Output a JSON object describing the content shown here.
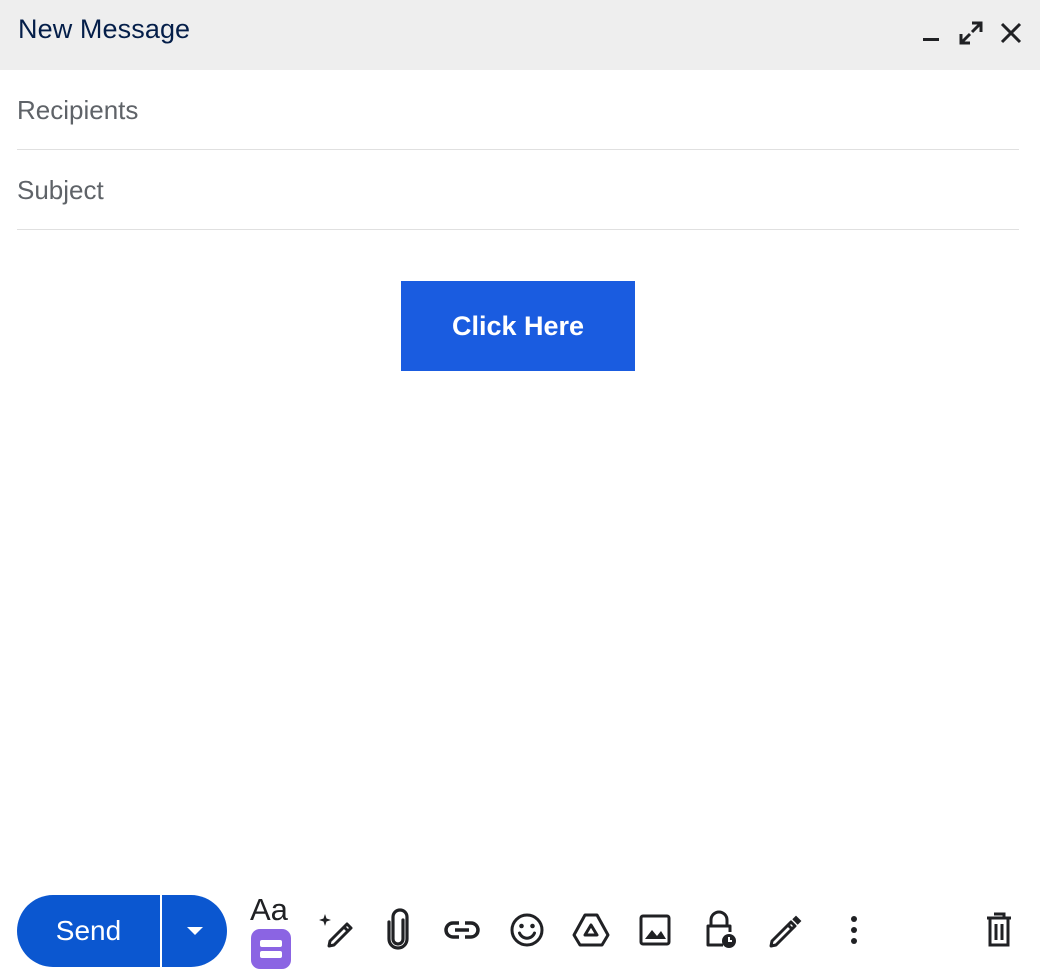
{
  "window": {
    "title": "New Message",
    "controls": [
      "minimize-icon",
      "expand-icon",
      "close-icon"
    ]
  },
  "fields": {
    "recipients": {
      "placeholder": "Recipients",
      "value": ""
    },
    "subject": {
      "placeholder": "Subject",
      "value": ""
    }
  },
  "body": {
    "cta_label": "Click Here",
    "cta_color": "#1a5ce0"
  },
  "toolbar": {
    "send_label": "Send",
    "send_color": "#0b57d0",
    "formatting_label": "Aa",
    "formatting_badge_color": "#8b64e3",
    "icons": [
      "send-options-icon",
      "formatting-icon",
      "ai-write-icon",
      "attach-icon",
      "link-icon",
      "emoji-icon",
      "drive-icon",
      "photo-icon",
      "confidential-icon",
      "signature-icon",
      "more-options-icon",
      "discard-icon"
    ]
  }
}
